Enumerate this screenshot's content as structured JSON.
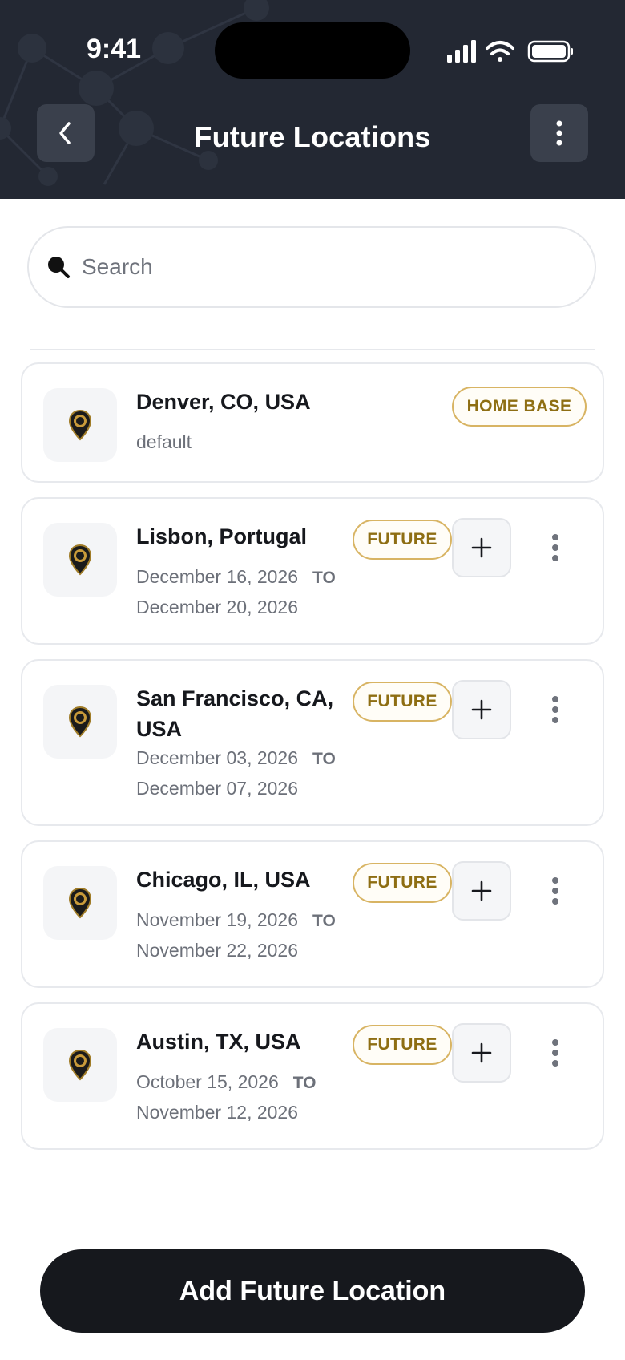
{
  "status_bar": {
    "time": "9:41"
  },
  "header": {
    "title": "Future Locations"
  },
  "search": {
    "placeholder": "Search",
    "value": ""
  },
  "colors": {
    "header_bg": "#232833",
    "badge_gold": "#8e6e13",
    "badge_border": "#d8b463",
    "primary": "#16181d"
  },
  "locations": [
    {
      "name": "Denver, CO, USA",
      "subtitle": "default",
      "badge": "HOME BASE"
    },
    {
      "name": "Lisbon, Portugal",
      "start": "December 16, 2026",
      "to": "TO",
      "end": "December 20, 2026",
      "badge": "FUTURE"
    },
    {
      "name": "San Francisco, CA, USA",
      "start": "December 03, 2026",
      "to": "TO",
      "end": "December 07, 2026",
      "badge": "FUTURE"
    },
    {
      "name": "Chicago, IL, USA",
      "start": "November 19, 2026",
      "to": "TO",
      "end": "November 22, 2026",
      "badge": "FUTURE"
    },
    {
      "name": "Austin, TX, USA",
      "start": "October 15, 2026",
      "to": "TO",
      "end": "November 12, 2026",
      "badge": "FUTURE"
    }
  ],
  "footer": {
    "add_button_label": "Add Future Location"
  }
}
